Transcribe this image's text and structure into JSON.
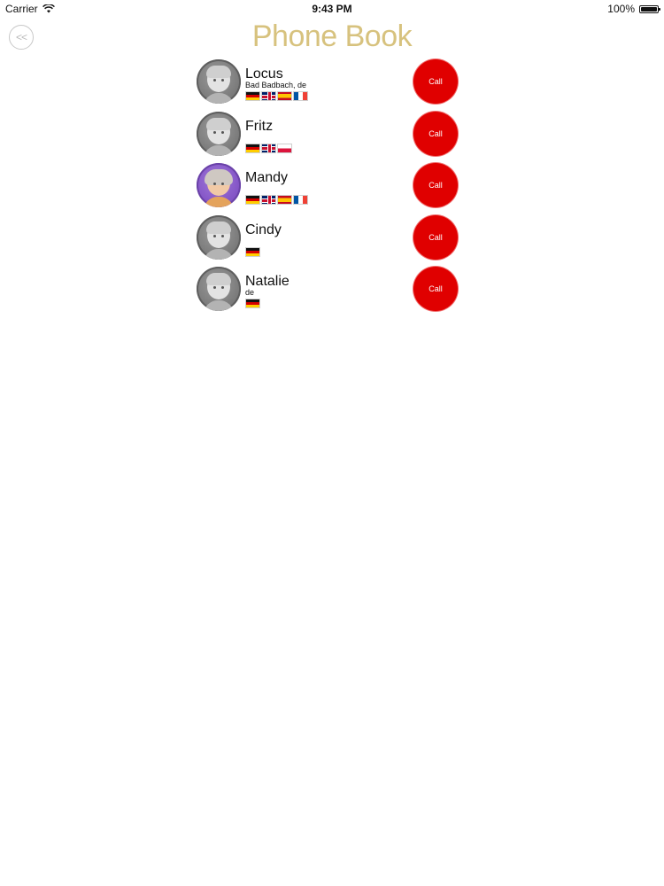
{
  "status_bar": {
    "carrier": "Carrier",
    "time": "9:43 PM",
    "battery": "100%"
  },
  "header": {
    "back_label": "<<",
    "title": "Phone Book"
  },
  "contacts": [
    {
      "name": "Locus",
      "subtitle": "Bad Badbach, de",
      "flags": [
        "de",
        "gb",
        "es",
        "fr"
      ],
      "avatar": "gray",
      "call_label": "Call"
    },
    {
      "name": "Fritz",
      "subtitle": "",
      "flags": [
        "de",
        "gb",
        "pl"
      ],
      "avatar": "gray",
      "call_label": "Call"
    },
    {
      "name": "Mandy",
      "subtitle": "",
      "flags": [
        "de",
        "gb",
        "es",
        "fr"
      ],
      "avatar": "purple",
      "call_label": "Call"
    },
    {
      "name": "Cindy",
      "subtitle": "",
      "flags": [
        "de"
      ],
      "avatar": "gray",
      "call_label": "Call"
    },
    {
      "name": "Natalie",
      "subtitle": "de",
      "flags": [
        "de"
      ],
      "avatar": "gray",
      "call_label": "Call"
    }
  ],
  "colors": {
    "title": "#d7c27e",
    "call_button": "#e00000"
  }
}
